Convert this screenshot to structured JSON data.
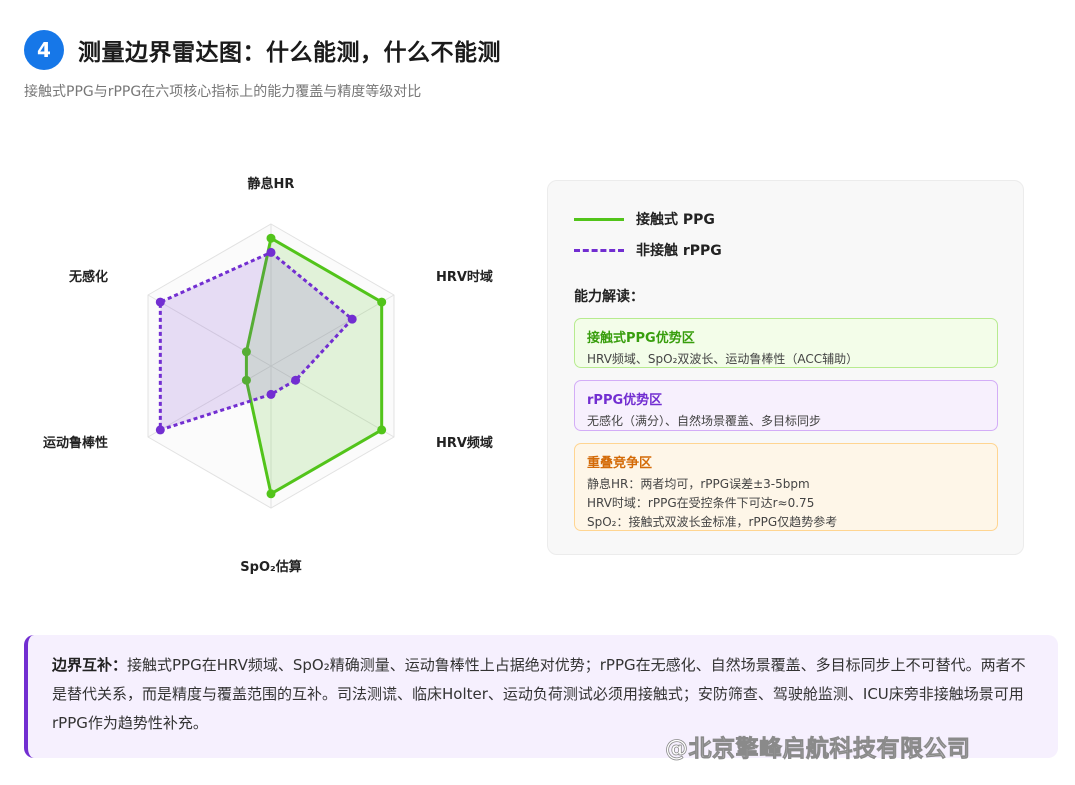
{
  "header": {
    "number": "4",
    "title": "测量边界雷达图：什么能测，什么不能测",
    "subtitle": "接触式PPG与rPPG在六项核心指标上的能力覆盖与精度等级对比"
  },
  "chart_data": {
    "type": "radar",
    "axes": [
      "静息HR",
      "HRV时域",
      "HRV频域",
      "SpO₂估算",
      "运动鲁棒性",
      "无感化"
    ],
    "max": 5,
    "series": [
      {
        "name": "接触式 PPG",
        "values": [
          4.5,
          4.5,
          4.5,
          4.5,
          1.0,
          1.0
        ],
        "color": "#52c41a",
        "style": "solid"
      },
      {
        "name": "非接触 rPPG",
        "values": [
          4.0,
          3.3,
          1.0,
          1.0,
          4.5,
          4.5
        ],
        "color": "#722ed1",
        "style": "dashed"
      }
    ],
    "grid": true
  },
  "legend": {
    "ppg_label": "接触式 PPG",
    "rppg_label": "非接触 rPPG"
  },
  "interpretation": {
    "title": "能力解读：",
    "zones": [
      {
        "title": "接触式PPG优势区",
        "lines": [
          "HRV频域、SpO₂双波长、运动鲁棒性（ACC辅助）"
        ]
      },
      {
        "title": "rPPG优势区",
        "lines": [
          "无感化（满分）、自然场景覆盖、多目标同步"
        ]
      },
      {
        "title": "重叠竞争区",
        "lines": [
          "静息HR：两者均可，rPPG误差±3-5bpm",
          "HRV时域：rPPG在受控条件下可达r≈0.75",
          "SpO₂：接触式双波长金标准，rPPG仅趋势参考"
        ]
      }
    ]
  },
  "note": {
    "lead": "边界互补：",
    "text": "接触式PPG在HRV频域、SpO₂精确测量、运动鲁棒性上占据绝对优势；rPPG在无感化、自然场景覆盖、多目标同步上不可替代。两者不是替代关系，而是精度与覆盖范围的互补。司法测谎、临床Holter、运动负荷测试必须用接触式；安防筛查、驾驶舱监测、ICU床旁非接触场景可用rPPG作为趋势性补充。"
  },
  "watermark": "@北京擎峰启航科技有限公司"
}
